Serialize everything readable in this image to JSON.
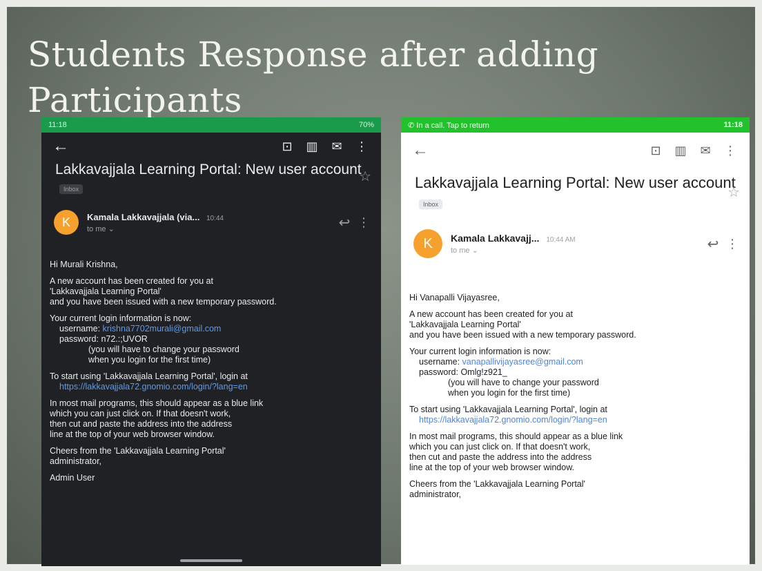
{
  "slide": {
    "title_line1": "Students Response after adding",
    "title_line2": "Participants"
  },
  "left_phone": {
    "status_time": "11:18",
    "status_right": "70%",
    "subject": "Lakkavajjala  Learning Portal: New user account",
    "badge": "Inbox",
    "avatar_letter": "K",
    "sender": "Kamala Lakkavajjala (via...",
    "time": "10:44",
    "recipient": "to me ⌄",
    "body": {
      "greeting": "Hi Murali Krishna,",
      "intro_1": "A new account has been created for you at",
      "intro_2": "'Lakkavajjala  Learning Portal'",
      "intro_3": "and you have been issued with a new temporary password.",
      "login_header": "Your current login information is now:",
      "username_label": "username:",
      "username_value": "krishna7702murali@gmail.com",
      "password_line": "password: n72.:;UVOR",
      "change_1": "(you will have to change your password",
      "change_2": "when you login for the first time)",
      "start_line": "To start using 'Lakkavajjala  Learning Portal', login at",
      "login_url": "https://lakkavajjala72.gnomio.com/login/?lang=en",
      "blue_1": "In most mail programs, this should appear as a blue link",
      "blue_2": "which you can just click on.  If that doesn't work,",
      "blue_3": "then cut and paste the address into the address",
      "blue_4": "line at the top of your web browser window.",
      "cheers_1": "Cheers from the 'Lakkavajjala  Learning Portal'",
      "cheers_2": "administrator,",
      "signature": "Admin User"
    }
  },
  "right_phone": {
    "status_left": "In a call. Tap to return",
    "status_time": "11:18",
    "subject": "Lakkavajjala  Learning Portal: New user account",
    "badge": "Inbox",
    "avatar_letter": "K",
    "sender": "Kamala Lakkavajj...",
    "time": "10:44 AM",
    "recipient": "to me ⌄",
    "body": {
      "greeting": "Hi Vanapalli Vijayasree,",
      "intro_1": "A new account has been created for you at",
      "intro_2": "'Lakkavajjala  Learning Portal'",
      "intro_3": "and you have been issued with a new temporary password.",
      "login_header": "Your current login information is now:",
      "username_label": "username:",
      "username_value": "vanapallivijayasree@gmail.com",
      "password_line": "password: Omlg!z921_",
      "change_1": "(you will have to change your password",
      "change_2": "when you login for the first time)",
      "start_line": "To start using 'Lakkavajjala  Learning Portal', login at",
      "login_url": "https://lakkavajjala72.gnomio.com/login/?lang=en",
      "blue_1": "In most mail programs, this should appear as a blue link",
      "blue_2": "which you can just click on.  If that doesn't work,",
      "blue_3": "then cut and paste the address into the address",
      "blue_4": "line at the top of your web browser window.",
      "cheers_1": "Cheers from the 'Lakkavajjala  Learning Portal'",
      "cheers_2": "administrator,"
    }
  }
}
